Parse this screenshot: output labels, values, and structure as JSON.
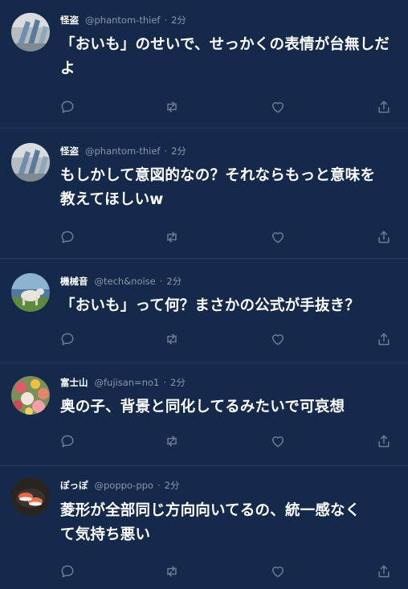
{
  "colors": {
    "background": "#15294a",
    "divider": "#213a5e",
    "muted": "#8a98ab",
    "icon": "#6b7c93"
  },
  "icons": {
    "reply": "reply-icon",
    "retweet": "retweet-icon",
    "like": "like-icon",
    "share": "share-icon"
  },
  "tweets": [
    {
      "name": "怪盗",
      "handle": "@phantom-thief",
      "separator": "·",
      "time": "2分",
      "lines": [
        "「おいも」のせいで、せっかくの表情が台無しだ",
        "よ"
      ]
    },
    {
      "name": "怪盗",
      "handle": "@phantom-thief",
      "separator": "·",
      "time": "2分",
      "lines": [
        "もしかして意図的なの？それならもっと意味を",
        "教えてほしいw"
      ]
    },
    {
      "name": "機械音",
      "handle": "@tech&noise",
      "separator": "·",
      "time": "2分",
      "lines": [
        "「おいも」って何？まさかの公式が手抜き？"
      ]
    },
    {
      "name": "富士山",
      "handle": "@fujisan=no1",
      "separator": "·",
      "time": "2分",
      "lines": [
        "奥の子、背景と同化してるみたいで可哀想"
      ]
    },
    {
      "name": "ぽっぽ",
      "handle": "@poppo-ppo",
      "separator": "·",
      "time": "2分",
      "lines": [
        "菱形が全部同じ方向向いてるの、統一感なく",
        "て気持ち悪い"
      ]
    }
  ]
}
